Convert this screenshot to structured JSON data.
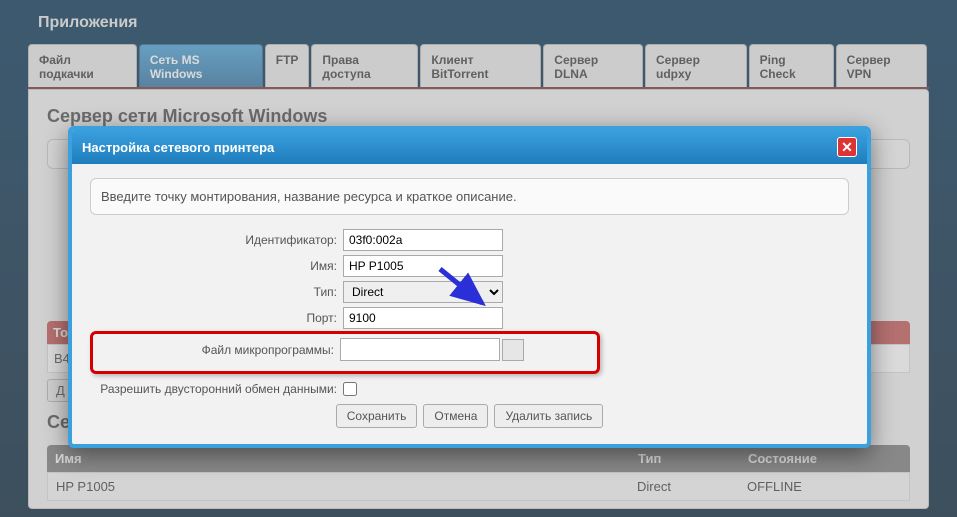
{
  "page": {
    "title": "Приложения"
  },
  "tabs": [
    {
      "label": "Файл подкачки"
    },
    {
      "label": "Сеть MS Windows",
      "active": true
    },
    {
      "label": "FTP"
    },
    {
      "label": "Права доступа"
    },
    {
      "label": "Клиент BitTorrent"
    },
    {
      "label": "Сервер DLNA"
    },
    {
      "label": "Сервер udpxy"
    },
    {
      "label": "Ping Check"
    },
    {
      "label": "Сервер VPN"
    }
  ],
  "section": {
    "title": "Сервер сети Microsoft Windows"
  },
  "topology": {
    "header": "То",
    "cell": "B4"
  },
  "add_btn": "Д",
  "printers": {
    "title": "Сетевые принтеры",
    "columns": {
      "name": "Имя",
      "type": "Тип",
      "state": "Состояние"
    },
    "rows": [
      {
        "name": "HP P1005",
        "type": "Direct",
        "state": "OFFLINE"
      }
    ]
  },
  "dialog": {
    "title": "Настройка сетевого принтера",
    "instruction": "Введите точку монтирования, название ресурса и краткое описание.",
    "labels": {
      "id": "Идентификатор:",
      "name": "Имя:",
      "type": "Тип:",
      "port": "Порт:",
      "firmware": "Файл микропрограммы:",
      "bidir": "Разрешить двусторонний обмен данными:"
    },
    "values": {
      "id": "03f0:002a",
      "name": "HP P1005",
      "type": "Direct",
      "port": "9100",
      "firmware": ""
    },
    "buttons": {
      "save": "Сохранить",
      "cancel": "Отмена",
      "delete": "Удалить запись"
    }
  }
}
